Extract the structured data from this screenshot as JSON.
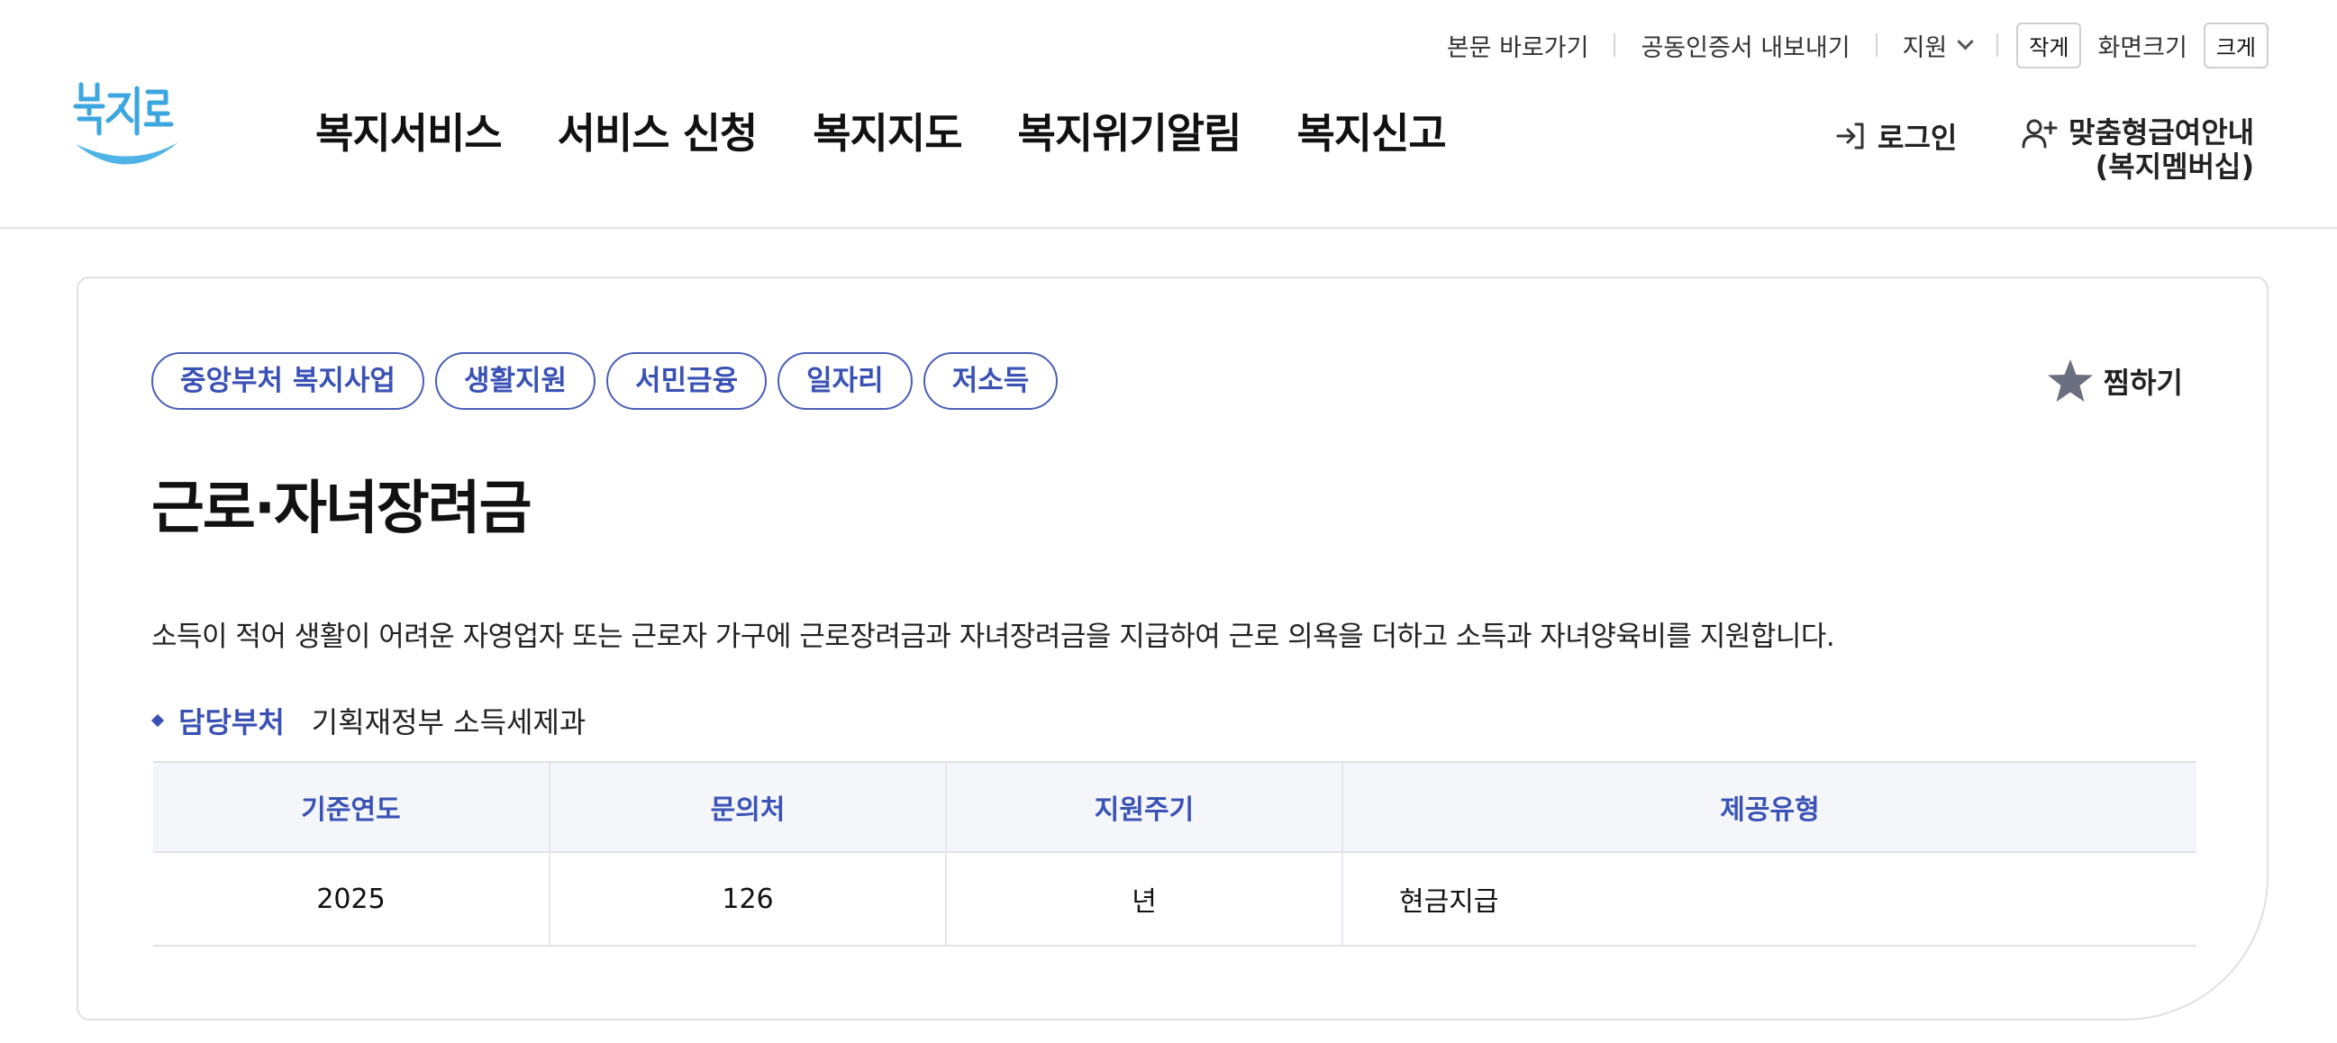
{
  "utility": {
    "skip_link": "본문 바로가기",
    "cert_export": "공동인증서 내보내기",
    "support": "지원",
    "size_small": "작게",
    "size_label": "화면크기",
    "size_large": "크게"
  },
  "nav": {
    "items": [
      "복지서비스",
      "서비스 신청",
      "복지지도",
      "복지위기알림",
      "복지신고"
    ]
  },
  "account": {
    "login": "로그인",
    "membership_line1": "맞춤형급여안내",
    "membership_line2": "(복지멤버십)"
  },
  "service": {
    "tags": [
      "중앙부처 복지사업",
      "생활지원",
      "서민금융",
      "일자리",
      "저소득"
    ],
    "favorite": "찜하기",
    "title": "근로·자녀장려금",
    "summary": "소득이 적어 생활이 어려운 자영업자 또는 근로자 가구에 근로장려금과 자녀장려금을 지급하여 근로 의욕을 더하고 소득과 자녀양육비를 지원합니다.",
    "dept_label": "담당부처",
    "dept_value": "기획재정부 소득세제과",
    "table": {
      "headers": [
        "기준연도",
        "문의처",
        "지원주기",
        "제공유형"
      ],
      "row": [
        "2025",
        "126",
        "년",
        "현금지급"
      ]
    }
  },
  "colors": {
    "accent": "#3a52b5",
    "logo_blue": "#4fb3e8",
    "star": "#6b6f80"
  },
  "icons": {
    "login": "login-arrow-icon",
    "membership": "user-plus-icon",
    "favorite": "star-icon",
    "support": "chevron-down-icon"
  }
}
